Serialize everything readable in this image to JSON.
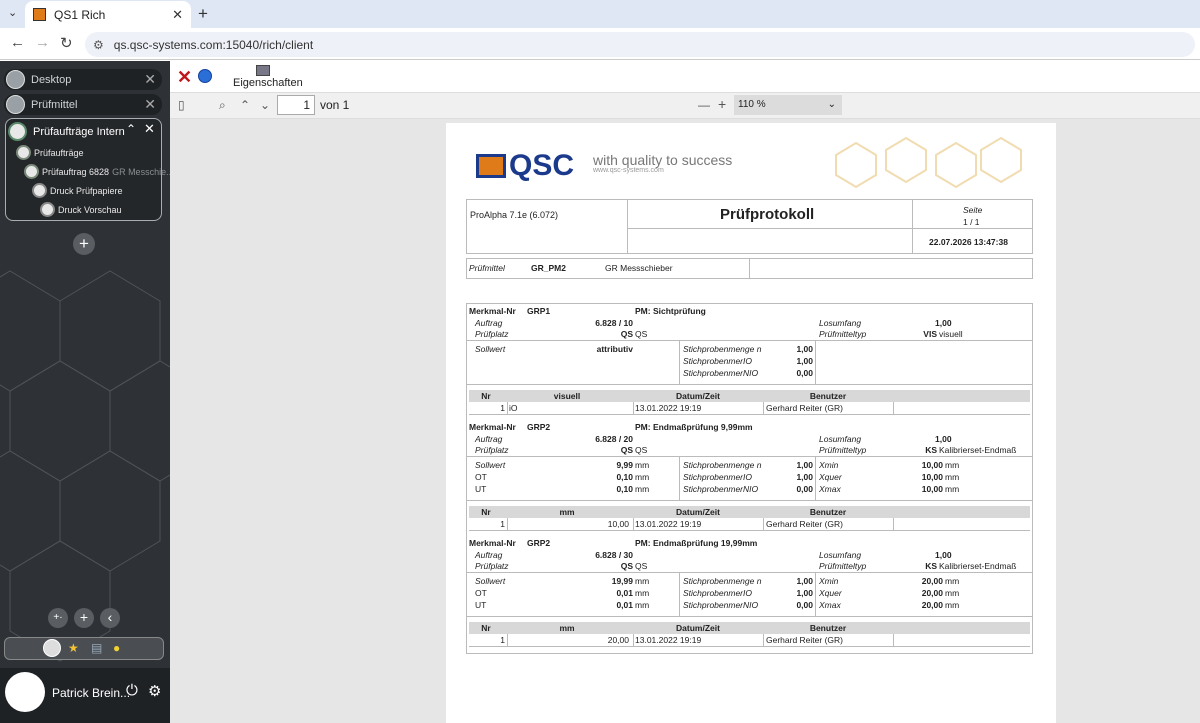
{
  "browser": {
    "tab_title": "QS1 Rich",
    "url": "qs.qsc-systems.com:15040/rich/client"
  },
  "sidebar": {
    "items": [
      {
        "label": "Desktop"
      },
      {
        "label": "Prüfmittel"
      }
    ],
    "group": {
      "title": "Prüfaufträge Intern",
      "children": [
        {
          "label": "Prüfaufträge"
        },
        {
          "label": "Prüfauftrag 6828",
          "sub": "GR Messchie..."
        },
        {
          "label": "Druck Prüfpapiere"
        },
        {
          "label": "Druck Vorschau"
        }
      ]
    },
    "user_name": "Patrick Brein..."
  },
  "toolbar": {
    "properties_label": "Eigenschaften"
  },
  "pdf": {
    "page_current": "1",
    "page_of": "von 1",
    "zoom": "110 %"
  },
  "doc": {
    "tagline": "with quality to success",
    "tagline_url": "www.qsc-systems.com",
    "logo_text": "QSC",
    "system": "ProAlpha 7.1e (6.072)",
    "title": "Prüfprotokoll",
    "page_label": "Seite",
    "page_value": "1 / 1",
    "datetime": "22.07.2026  13:47:38",
    "pruefmittel_label": "Prüfmittel",
    "pruefmittel_code": "GR_PM2",
    "pruefmittel_name": "GR Messschieber",
    "merkmale": [
      {
        "nr_label": "Merkmal-Nr",
        "nr": "GRP1",
        "pm": "PM: Sichtprüfung",
        "auftrag": "6.828 / 10",
        "platz_code": "QS",
        "platz": "QS",
        "losumfang": "1,00",
        "typ_code": "VIS",
        "typ": "visuell",
        "sollwert": "attributiv",
        "rows": [],
        "stich_n": "1,00",
        "stich_io": "1,00",
        "stich_nio": "0,00",
        "col2": "visuell",
        "result": {
          "nr": "1",
          "val": "iO",
          "date": "13.01.2022 19:19",
          "user": "Gerhard Reiter (GR)"
        }
      },
      {
        "nr_label": "Merkmal-Nr",
        "nr": "GRP2",
        "pm": "PM: Endmaßprüfung 9,99mm",
        "auftrag": "6.828 / 20",
        "platz_code": "QS",
        "platz": "QS",
        "losumfang": "1,00",
        "typ_code": "KS",
        "typ": "Kalibrierset-Endmaß",
        "sollwert": "9,99",
        "ot": "0,10",
        "ut": "0,10",
        "unit": "mm",
        "stich_n": "1,00",
        "stich_io": "1,00",
        "stich_nio": "0,00",
        "xmin": "10,00",
        "xquer": "10,00",
        "xmax": "10,00",
        "col2": "mm",
        "result": {
          "nr": "1",
          "val": "10,00",
          "date": "13.01.2022 19:19",
          "user": "Gerhard Reiter (GR)"
        }
      },
      {
        "nr_label": "Merkmal-Nr",
        "nr": "GRP2",
        "pm": "PM: Endmaßprüfung 19,99mm",
        "auftrag": "6.828 / 30",
        "platz_code": "QS",
        "platz": "QS",
        "losumfang": "1,00",
        "typ_code": "KS",
        "typ": "Kalibrierset-Endmaß",
        "sollwert": "19,99",
        "ot": "0,01",
        "ut": "0,01",
        "unit": "mm",
        "stich_n": "1,00",
        "stich_io": "1,00",
        "stich_nio": "0,00",
        "xmin": "20,00",
        "xquer": "20,00",
        "xmax": "20,00",
        "col2": "mm",
        "result": {
          "nr": "1",
          "val": "20,00",
          "date": "13.01.2022 19:19",
          "user": "Gerhard Reiter (GR)"
        }
      }
    ],
    "labels": {
      "auftrag": "Auftrag",
      "platz": "Prüfplatz",
      "losumfang": "Losumfang",
      "typ": "Prüfmitteltyp",
      "sollwert": "Sollwert",
      "ot": "OT",
      "ut": "UT",
      "stich_n": "Stichprobenmenge n",
      "stich_io": "StichprobenmerIO",
      "stich_nio": "StichprobenmerNIO",
      "xmin": "Xmin",
      "xquer": "Xquer",
      "xmax": "Xmax",
      "h_nr": "Nr",
      "h_date": "Datum/Zeit",
      "h_user": "Benutzer"
    }
  }
}
